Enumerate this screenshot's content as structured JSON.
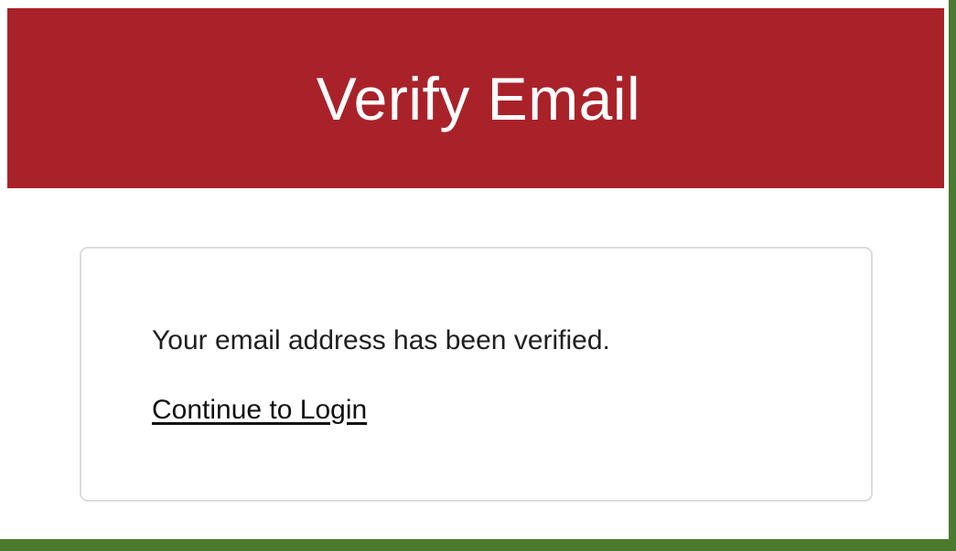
{
  "colors": {
    "header_background": "#a9222a",
    "border_accent": "#4b7a2e",
    "card_border": "#dcdcdc",
    "text": "#202020"
  },
  "header": {
    "title": "Verify Email"
  },
  "card": {
    "message": "Your email address has been verified.",
    "link_label": "Continue to Login"
  }
}
